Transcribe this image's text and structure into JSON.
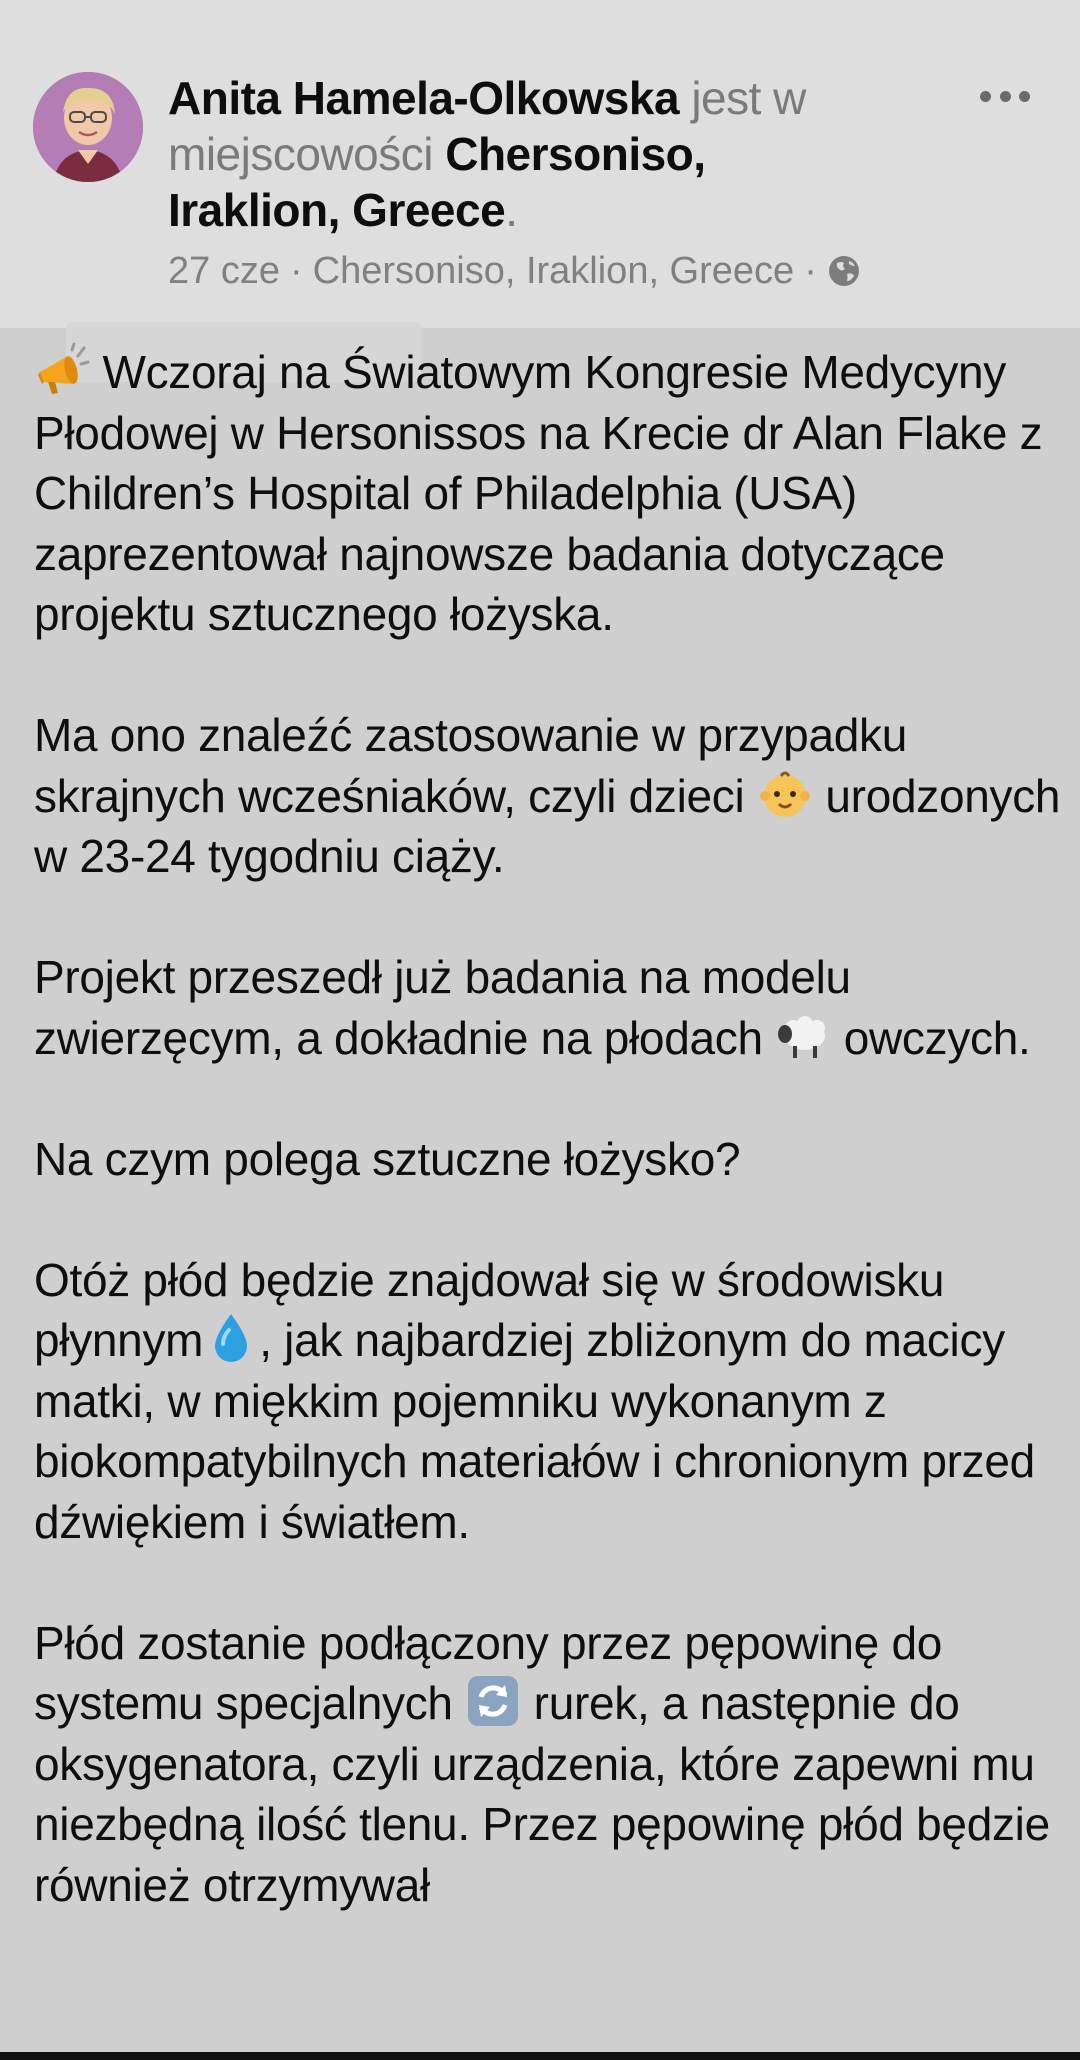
{
  "post": {
    "author_name": "Anita Hamela-Olkowska",
    "is_in_text": "jest w miejscowości",
    "place": "Chersoniso, Iraklion, Greece",
    "place_end": ".",
    "date": "27 cze",
    "separator": "·",
    "location": "Chersoniso, Iraklion, Greece",
    "privacy_icon": "globe-icon",
    "more_icon": "more-dots-icon",
    "paragraphs": {
      "p1": "Wczoraj na Światowym Kongresie Medycyny Płodowej w Hersonissos na Krecie dr Alan Flake z Children’s Hospital of Philadelphia (USA) zaprezentował najnowsze badania dotyczące projektu sztucznego łożyska.",
      "p2a": "Ma ono znaleźć zastosowanie w przypadku skrajnych wcześniaków, czyli dzieci",
      "p2b": "urodzonych w 23-24 tygodniu ciąży.",
      "p3a": "Projekt przeszedł już badania na modelu zwierzęcym, a dokładnie na płodach",
      "p3b": "owczych.",
      "p4": "Na czym polega sztuczne łożysko?",
      "p5a": "Otóż płód będzie znajdował się w środowisku płynnym",
      "p5b": ", jak najbardziej zbliżonym do macicy matki, w miękkim pojemniku wykonanym z biokompatybilnych materiałów i chronionym przed dźwiękiem i światłem.",
      "p6a": "Płód zostanie podłączony przez pępowinę do systemu specjalnych",
      "p6b": "rurek, a następnie do oksygenatora, czyli urządzenia, które zapewni mu niezbędną ilość tlenu. Przez pępowinę płód będzie również otrzymywał"
    },
    "emojis": {
      "megaphone": "megaphone-emoji",
      "baby": "baby-emoji",
      "sheep": "sheep-emoji",
      "droplet": "droplet-emoji",
      "arrows": "counterclockwise-arrows-emoji"
    }
  }
}
